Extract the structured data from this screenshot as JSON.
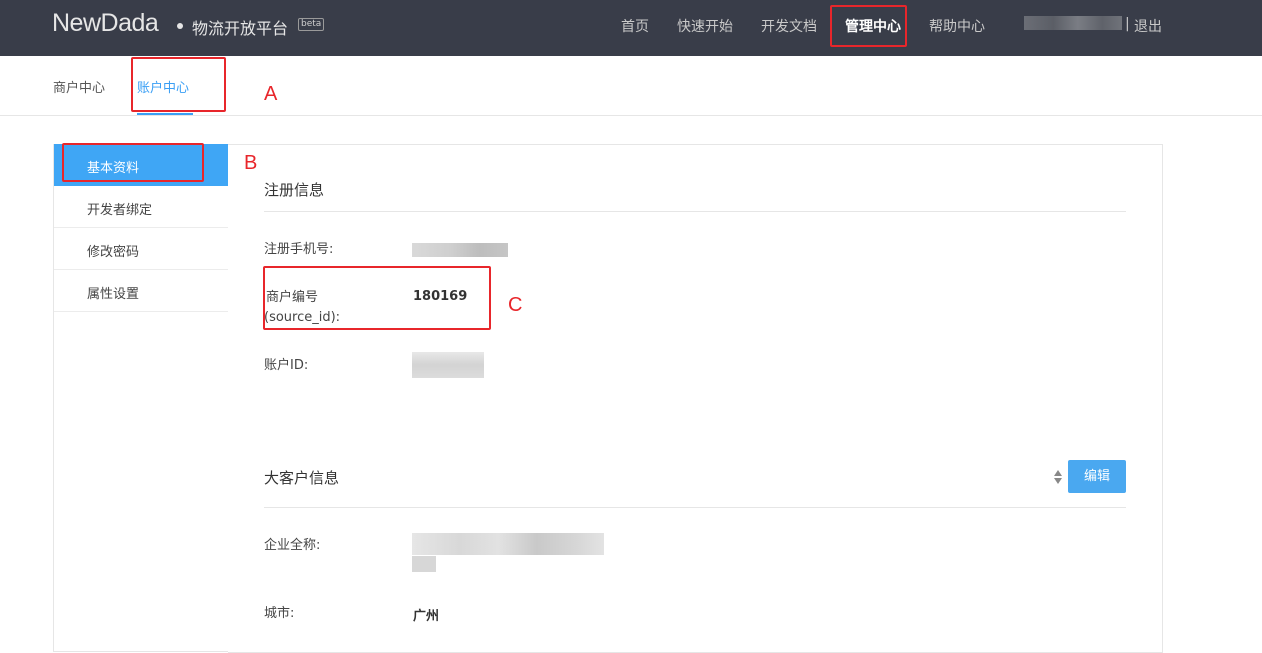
{
  "header": {
    "logo": "NewDada",
    "platform": "物流开放平台",
    "beta": "beta",
    "nav": [
      "首页",
      "快速开始",
      "开发文档",
      "管理中心",
      "帮助中心"
    ],
    "separator": "|",
    "logout": "退出"
  },
  "subtabs": [
    "商户中心",
    "账户中心"
  ],
  "sidebar": {
    "items": [
      "基本资料",
      "开发者绑定",
      "修改密码",
      "属性设置"
    ]
  },
  "registration": {
    "title": "注册信息",
    "phone_label": "注册手机号:",
    "source_label_line1": "商户编号",
    "source_label_line2": "(source_id):",
    "source_value": "180169",
    "account_label": "账户ID:"
  },
  "customer": {
    "title": "大客户信息",
    "edit_label": "编辑",
    "company_label": "企业全称:",
    "city_label": "城市:",
    "city_value": "广州"
  },
  "annotations": [
    "A",
    "B",
    "C"
  ],
  "colors": {
    "topbar": "#393d49",
    "accent": "#3a9ff5",
    "annotation": "#e8262b"
  }
}
